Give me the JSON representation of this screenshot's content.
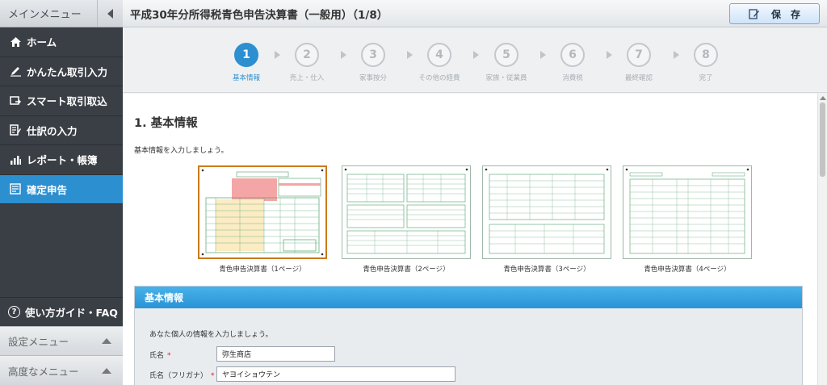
{
  "sidebar": {
    "header": "メインメニュー",
    "items": [
      {
        "label": "ホーム",
        "icon": "home-icon"
      },
      {
        "label": "かんたん取引入力",
        "icon": "pencil-icon"
      },
      {
        "label": "スマート取引取込",
        "icon": "import-icon"
      },
      {
        "label": "仕訳の入力",
        "icon": "journal-icon"
      },
      {
        "label": "レポート・帳簿",
        "icon": "report-icon"
      },
      {
        "label": "確定申告",
        "icon": "tax-return-icon",
        "active": true
      }
    ],
    "guide": "使い方ガイド・FAQ",
    "settings_menu": "設定メニュー",
    "advanced_menu": "高度なメニュー"
  },
  "header": {
    "title": "平成30年分所得税青色申告決算書（一般用）（1/8）",
    "save_label": "保　存"
  },
  "steps": [
    {
      "number": "1",
      "label": "基本情報",
      "active": true
    },
    {
      "number": "2",
      "label": "売上・仕入"
    },
    {
      "number": "3",
      "label": "家事按分"
    },
    {
      "number": "4",
      "label": "その他の経費"
    },
    {
      "number": "5",
      "label": "家族・従業員"
    },
    {
      "number": "6",
      "label": "消費税"
    },
    {
      "number": "7",
      "label": "最終確認"
    },
    {
      "number": "8",
      "label": "完了"
    }
  ],
  "main": {
    "section_title": "1.  基本情報",
    "intro": "基本情報を入力しましょう。",
    "thumbnails": [
      {
        "label": "青色申告決算書（1ページ）",
        "selected": true
      },
      {
        "label": "青色申告決算書（2ページ）"
      },
      {
        "label": "青色申告決算書（3ページ）"
      },
      {
        "label": "青色申告決算書（4ページ）"
      }
    ],
    "panel": {
      "title": "基本情報",
      "intro": "あなた個人の情報を入力しましょう。",
      "fields": [
        {
          "label": "氏名",
          "required_mark": "*",
          "value": "弥生商店"
        },
        {
          "label": "氏名（フリガナ）",
          "required_mark": "*",
          "value": "ヤヨイショウテン"
        }
      ]
    }
  },
  "colors": {
    "accent": "#2c8fd0",
    "sidebar_bg": "#3a3f45",
    "selected_border": "#cc7a1a",
    "form_green": "#4fa06a",
    "form_pink": "#f4a6a6"
  }
}
